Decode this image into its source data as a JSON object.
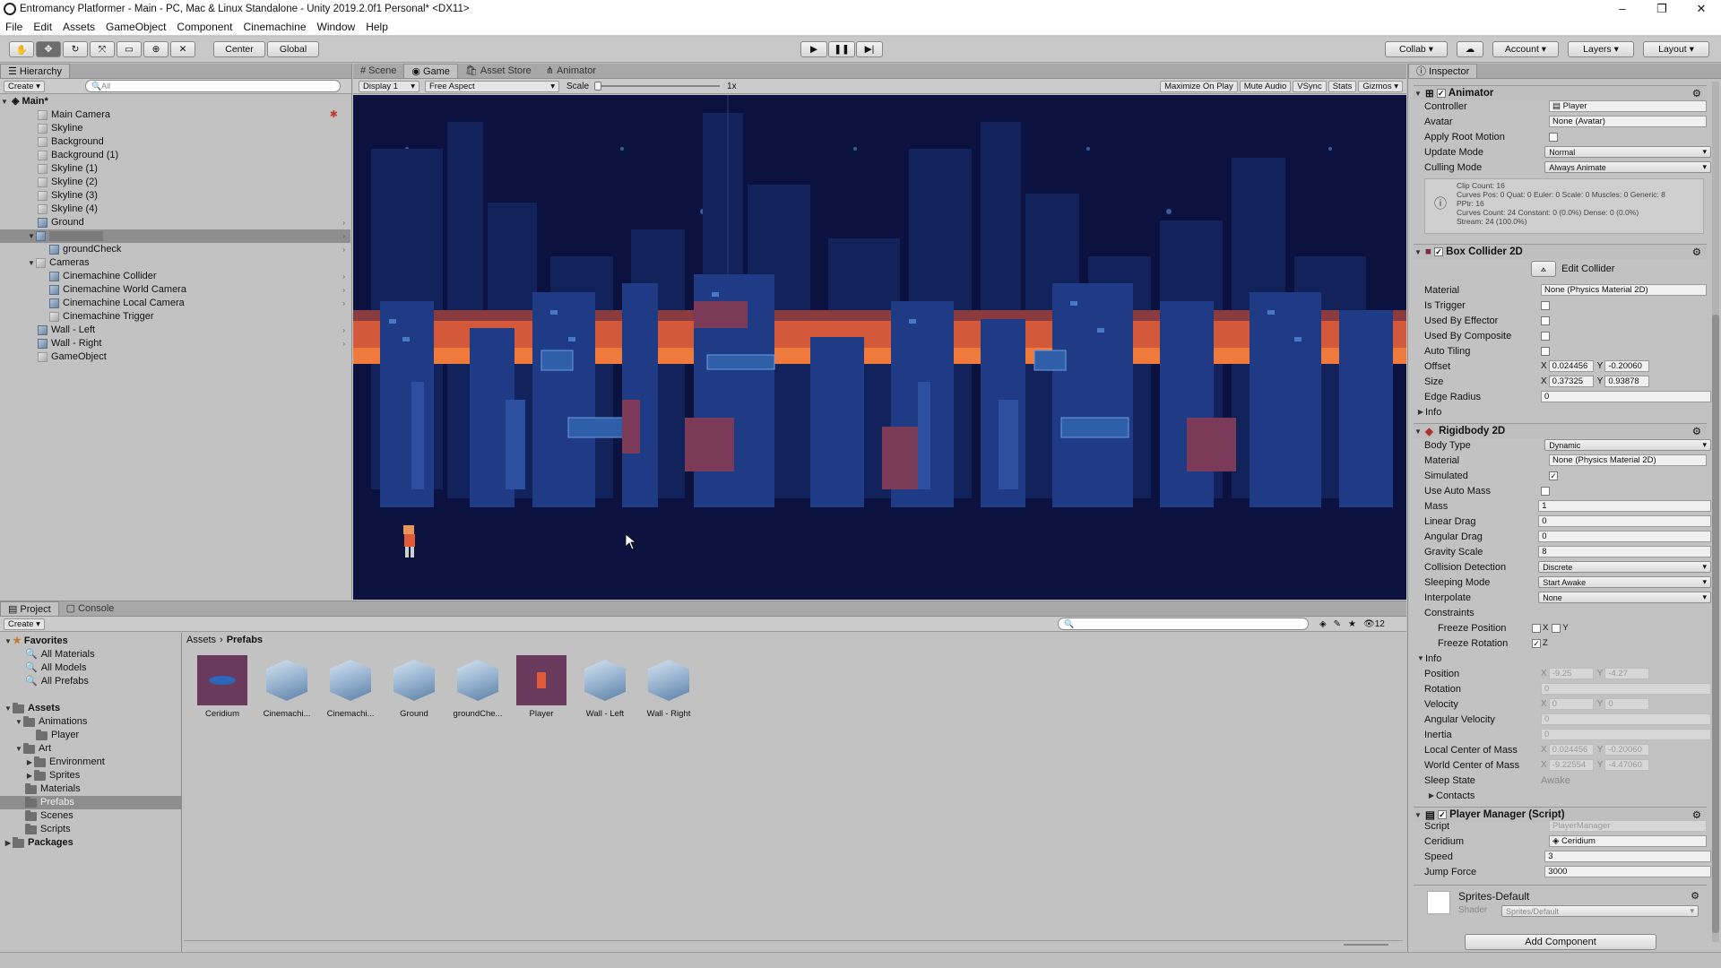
{
  "window": {
    "title": "Entromancy Platformer - Main - PC, Mac & Linux Standalone - Unity 2019.2.0f1 Personal* <DX11>"
  },
  "menu": [
    "File",
    "Edit",
    "Assets",
    "GameObject",
    "Component",
    "Cinemachine",
    "Window",
    "Help"
  ],
  "toolbar": {
    "pivot": "Center",
    "space": "Global",
    "collab": "Collab",
    "account": "Account",
    "layers": "Layers",
    "layout": "Layout"
  },
  "hierarchy": {
    "tab": "Hierarchy",
    "create": "Create",
    "search": "All",
    "scene": "Main*",
    "items": [
      "Main Camera",
      "Skyline",
      "Background",
      "Background (1)",
      "Skyline (1)",
      "Skyline (2)",
      "Skyline (3)",
      "Skyline (4)",
      "Ground",
      "groundCheck",
      "Cameras",
      "Cinemachine Collider",
      "Cinemachine World Camera",
      "Cinemachine Local Camera",
      "Cinemachine Trigger",
      "Wall - Left",
      "Wall - Right",
      "GameObject"
    ]
  },
  "game": {
    "tabs": [
      "Scene",
      "Game",
      "Asset Store",
      "Animator"
    ],
    "display": "Display 1",
    "aspect": "Free Aspect",
    "scale_label": "Scale",
    "scale_value": "1x",
    "buttons": [
      "Maximize On Play",
      "Mute Audio",
      "VSync",
      "Stats",
      "Gizmos"
    ]
  },
  "project": {
    "tabs": [
      "Project",
      "Console"
    ],
    "create": "Create",
    "count": "12",
    "favorites": "Favorites",
    "fav_items": [
      "All Materials",
      "All Models",
      "All Prefabs"
    ],
    "assets": "Assets",
    "tree": [
      "Animations",
      "Player",
      "Art",
      "Environment",
      "Sprites",
      "Materials",
      "Prefabs",
      "Scenes",
      "Scripts"
    ],
    "packages": "Packages",
    "breadcrumb": [
      "Assets",
      "Prefabs"
    ],
    "prefabs": [
      "Ceridium",
      "Cinemachi...",
      "Cinemachi...",
      "Ground",
      "groundChe...",
      "Player",
      "Wall - Left",
      "Wall - Right"
    ]
  },
  "inspector": {
    "tab": "Inspector",
    "animator": {
      "title": "Animator",
      "rows": [
        [
          "Controller",
          "Player"
        ],
        [
          "Avatar",
          "None (Avatar)"
        ],
        [
          "Apply Root Motion",
          ""
        ],
        [
          "Update Mode",
          "Normal"
        ],
        [
          "Culling Mode",
          "Always Animate"
        ]
      ],
      "info": [
        "Clip Count: 16",
        "Curves Pos: 0 Quat: 0 Euler: 0 Scale: 0 Muscles: 0 Generic: 8",
        "PPtr: 16",
        "Curves Count: 24 Constant: 0 (0.0%) Dense: 0 (0.0%)",
        "Stream: 24 (100.0%)"
      ]
    },
    "box": {
      "title": "Box Collider 2D",
      "edit": "Edit Collider",
      "rows": [
        [
          "Material",
          "None (Physics Material 2D)"
        ],
        [
          "Is Trigger",
          ""
        ],
        [
          "Used By Effector",
          ""
        ],
        [
          "Used By Composite",
          ""
        ],
        [
          "Auto Tiling",
          ""
        ],
        [
          "Offset",
          ""
        ],
        [
          "Size",
          ""
        ],
        [
          "Edge Radius",
          "0"
        ]
      ],
      "offset_x": "0.024456",
      "offset_y": "-0.20060",
      "size_x": "0.37325",
      "size_y": "0.93878",
      "info": "Info"
    },
    "rb": {
      "title": "Rigidbody 2D",
      "rows": [
        [
          "Body Type",
          "Dynamic"
        ],
        [
          "Material",
          "None (Physics Material 2D)"
        ],
        [
          "Simulated",
          ""
        ],
        [
          "Use Auto Mass",
          ""
        ],
        [
          "Mass",
          "1"
        ],
        [
          "Linear Drag",
          "0"
        ],
        [
          "Angular Drag",
          "0"
        ],
        [
          "Gravity Scale",
          "8"
        ],
        [
          "Collision Detection",
          "Discrete"
        ],
        [
          "Sleeping Mode",
          "Start Awake"
        ],
        [
          "Interpolate",
          "None"
        ],
        [
          "Constraints",
          ""
        ],
        [
          "Freeze Position",
          ""
        ],
        [
          "Freeze Rotation",
          ""
        ]
      ],
      "info": "Info",
      "inforows": [
        [
          "Position",
          "X",
          "-9.25",
          "Y",
          "-4.27"
        ],
        [
          "Rotation",
          "",
          "0",
          "",
          ""
        ],
        [
          "Velocity",
          "X",
          "0",
          "Y",
          "0"
        ],
        [
          "Angular Velocity",
          "",
          "0",
          "",
          ""
        ],
        [
          "Inertia",
          "",
          "0",
          "",
          ""
        ],
        [
          "Local Center of Mass",
          "X",
          "0.024456",
          "Y",
          "-0.20060"
        ],
        [
          "World Center of Mass",
          "X",
          "-9.22554",
          "Y",
          "-4.47060"
        ],
        [
          "Sleep State",
          "",
          "Awake",
          "",
          ""
        ]
      ],
      "contacts": "Contacts"
    },
    "pm": {
      "title": "Player Manager (Script)",
      "rows": [
        [
          "Script",
          "PlayerManager"
        ],
        [
          "Ceridium",
          "Ceridium"
        ],
        [
          "Speed",
          "3"
        ],
        [
          "Jump Force",
          "3000"
        ]
      ]
    },
    "mat": {
      "title": "Sprites-Default",
      "shader_label": "Shader",
      "shader": "Sprites/Default"
    },
    "add": "Add Component"
  }
}
